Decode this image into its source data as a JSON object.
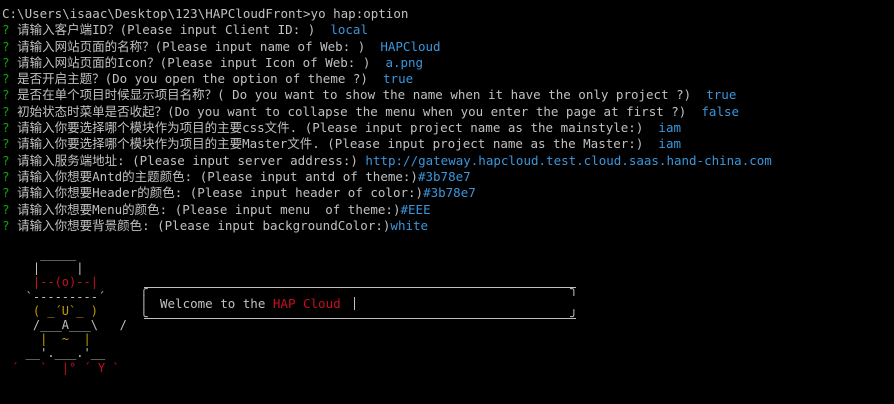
{
  "command_line": "C:\\Users\\isaac\\Desktop\\123\\HAPCloudFront>yo hap:option",
  "prompts": [
    {
      "mark": "?",
      "question": "请输入客户端ID？(Please input Client ID: )",
      "answer": "local"
    },
    {
      "mark": "?",
      "question": "请输入网站页面的名称？(Please input name of Web: )",
      "answer": "HAPCloud"
    },
    {
      "mark": "?",
      "question": "请输入网站页面的Icon？(Please input Icon of Web: )",
      "answer": "a.png"
    },
    {
      "mark": "?",
      "question": "是否开启主题？(Do you open the option of theme ?)",
      "answer": "true"
    },
    {
      "mark": "?",
      "question": "是否在单个项目时候显示项目名称？( Do you want to show the name when it have the only project ?)",
      "answer": "true"
    },
    {
      "mark": "?",
      "question": "初始状态时菜单是否收起？(Do you want to collapse the menu when you enter the page at first ?)",
      "answer": "false"
    },
    {
      "mark": "?",
      "question": "请输入你要选择哪个模块作为项目的主要css文件. (Please input project name as the mainstyle:)",
      "answer": "iam"
    },
    {
      "mark": "?",
      "question": "请输入你要选择哪个模块作为项目的主要Master文件. (Please input project name as the Master:)",
      "answer": "iam"
    },
    {
      "mark": "?",
      "question": "请输入服务端地址: (Please input server address:)",
      "answer": "http://gateway.hapcloud.test.cloud.saas.hand-china.com"
    },
    {
      "mark": "?",
      "question": "请输入你想要Antd的主题颜色: (Please input antd of theme:)",
      "answer": "#3b78e7"
    },
    {
      "mark": "?",
      "question": "请输入你想要Header的颜色: (Please input header of color:)",
      "answer": "#3b78e7"
    },
    {
      "mark": "?",
      "question": "请输入你想要Menu的颜色: (Please input menu  of theme:)",
      "answer": "#EEE"
    },
    {
      "mark": "?",
      "question": "请输入你想要背景颜色: (Please input backgroundColor:)",
      "answer": "white"
    }
  ],
  "yeoman": {
    "l1": "     _____",
    "l2": "    |     |",
    "l3": "    |--(o)--|",
    "l4": "   `---------´",
    "l5": "    ( _´U`_ )",
    "l6": "    /___A___\\   /",
    "l7": "     |  ~  |",
    "l8": "   __'.___.'__",
    "l9": " ´   `  |° ´ Y `"
  },
  "greeting": {
    "prefix": "Welcome to the ",
    "brand": "HAP Cloud",
    "suffix": " "
  },
  "colors": {
    "background": "#000000",
    "text": "#c0c0c0",
    "prompt_mark": "#13a10e",
    "answer": "#3a96dd",
    "brand": "#c50f1f"
  }
}
